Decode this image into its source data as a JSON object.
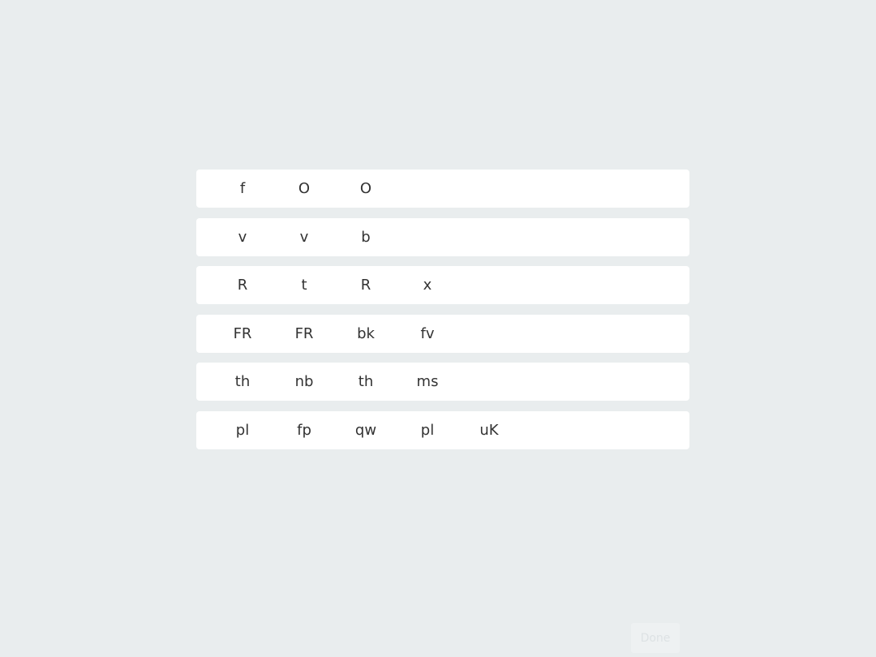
{
  "rows": [
    [
      "f",
      "O",
      "O"
    ],
    [
      "v",
      "v",
      "b"
    ],
    [
      "R",
      "t",
      "R",
      "x"
    ],
    [
      "FR",
      "FR",
      "bk",
      "fv"
    ],
    [
      "th",
      "nb",
      "th",
      "ms"
    ],
    [
      "pl",
      "fp",
      "qw",
      "pl",
      "uK"
    ]
  ],
  "done_button": {
    "label": "Done"
  }
}
